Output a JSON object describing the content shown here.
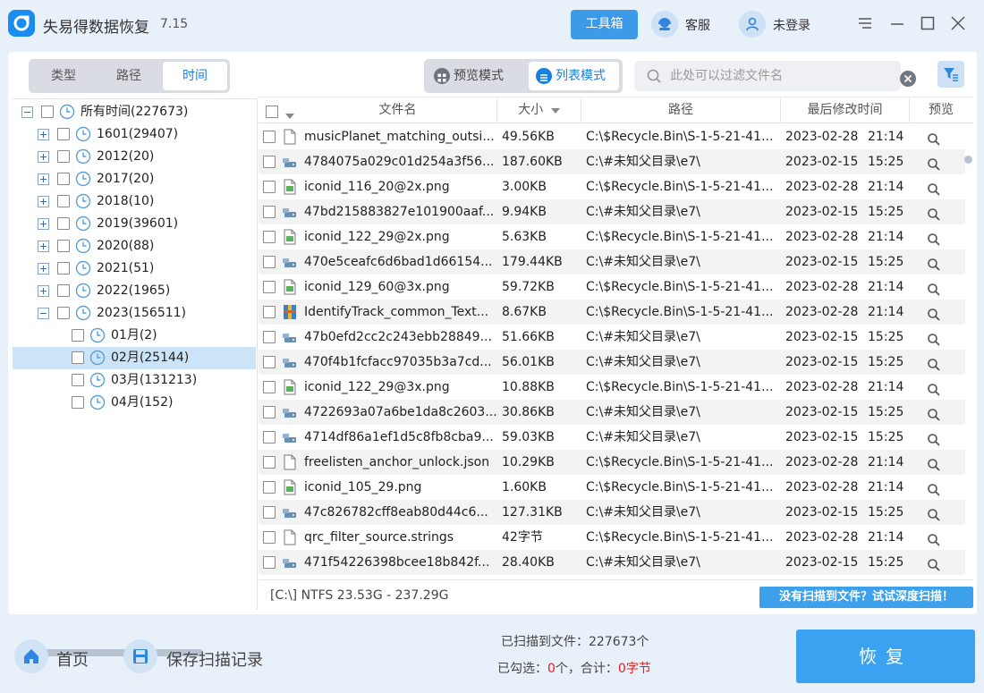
{
  "app": {
    "title": "失易得数据恢复",
    "version": "7.15"
  },
  "header": {
    "toolbox_label": "工具箱",
    "service_label": "客服",
    "login_label": "未登录"
  },
  "tabs": [
    {
      "label": "类型",
      "active": false
    },
    {
      "label": "路径",
      "active": false
    },
    {
      "label": "时间",
      "active": true
    }
  ],
  "view_modes": [
    {
      "label": "预览模式",
      "active": false
    },
    {
      "label": "列表模式",
      "active": true
    }
  ],
  "filter": {
    "placeholder": "此处可以过滤文件名",
    "value": ""
  },
  "tree": {
    "root": {
      "label": "所有时间(227673)"
    },
    "years": [
      {
        "label": "1601(29407)"
      },
      {
        "label": "2012(20)"
      },
      {
        "label": "2017(20)"
      },
      {
        "label": "2018(10)"
      },
      {
        "label": "2019(39601)"
      },
      {
        "label": "2020(88)"
      },
      {
        "label": "2021(51)"
      },
      {
        "label": "2022(1965)"
      },
      {
        "label": "2023(156511)"
      }
    ],
    "months": [
      {
        "label": "01月(2)"
      },
      {
        "label": "02月(25144)"
      },
      {
        "label": "03月(131213)"
      },
      {
        "label": "04月(152)"
      }
    ]
  },
  "table": {
    "columns": {
      "name": "文件名",
      "size": "大小",
      "path": "路径",
      "modified": "最后修改时间",
      "preview": "预览"
    },
    "rows": [
      {
        "name": "musicPlanet_matching_outsi...",
        "size": "49.56KB",
        "path": "C:\\$Recycle.Bin\\S-1-5-21-41...",
        "date": "2023-02-28",
        "time": "21:14",
        "icon": "blank-file-icon"
      },
      {
        "name": "4784075a029c01d254a3f56...",
        "size": "187.60KB",
        "path": "C:\\#未知父目录\\e7\\",
        "date": "2023-02-15",
        "time": "15:25",
        "icon": "drive-file-icon"
      },
      {
        "name": "iconid_116_20@2x.png",
        "size": "3.00KB",
        "path": "C:\\$Recycle.Bin\\S-1-5-21-41...",
        "date": "2023-02-28",
        "time": "21:14",
        "icon": "image-file-icon"
      },
      {
        "name": "47bd215883827e101900aaf...",
        "size": "9.94KB",
        "path": "C:\\#未知父目录\\e7\\",
        "date": "2023-02-15",
        "time": "15:25",
        "icon": "drive-file-icon"
      },
      {
        "name": "iconid_122_29@2x.png",
        "size": "5.63KB",
        "path": "C:\\$Recycle.Bin\\S-1-5-21-41...",
        "date": "2023-02-28",
        "time": "21:14",
        "icon": "image-file-icon"
      },
      {
        "name": "470e5ceafc6d6bad1d66154...",
        "size": "179.44KB",
        "path": "C:\\#未知父目录\\e7\\",
        "date": "2023-02-15",
        "time": "15:25",
        "icon": "drive-file-icon"
      },
      {
        "name": "iconid_129_60@3x.png",
        "size": "59.72KB",
        "path": "C:\\$Recycle.Bin\\S-1-5-21-41...",
        "date": "2023-02-28",
        "time": "21:14",
        "icon": "image-file-icon"
      },
      {
        "name": "IdentifyTrack_common_Text...",
        "size": "8.67KB",
        "path": "C:\\$Recycle.Bin\\S-1-5-21-41...",
        "date": "2023-02-28",
        "time": "21:14",
        "icon": "archive-file-icon"
      },
      {
        "name": "47b0efd2cc2c243ebb28849...",
        "size": "51.66KB",
        "path": "C:\\#未知父目录\\e7\\",
        "date": "2023-02-15",
        "time": "15:25",
        "icon": "drive-file-icon"
      },
      {
        "name": "470f4b1fcfacc97035b3a7cd...",
        "size": "56.01KB",
        "path": "C:\\#未知父目录\\e7\\",
        "date": "2023-02-15",
        "time": "15:25",
        "icon": "drive-file-icon"
      },
      {
        "name": "iconid_122_29@3x.png",
        "size": "10.88KB",
        "path": "C:\\$Recycle.Bin\\S-1-5-21-41...",
        "date": "2023-02-28",
        "time": "21:14",
        "icon": "image-file-icon"
      },
      {
        "name": "4722693a07a6be1da8c2603...",
        "size": "30.86KB",
        "path": "C:\\#未知父目录\\e7\\",
        "date": "2023-02-15",
        "time": "15:25",
        "icon": "drive-file-icon"
      },
      {
        "name": "4714df86a1ef1d5c8fb8cba9...",
        "size": "59.03KB",
        "path": "C:\\#未知父目录\\e7\\",
        "date": "2023-02-15",
        "time": "15:25",
        "icon": "drive-file-icon"
      },
      {
        "name": "freelisten_anchor_unlock.json",
        "size": "10.29KB",
        "path": "C:\\$Recycle.Bin\\S-1-5-21-41...",
        "date": "2023-02-28",
        "time": "21:14",
        "icon": "blank-file-icon"
      },
      {
        "name": "iconid_105_29.png",
        "size": "1.60KB",
        "path": "C:\\$Recycle.Bin\\S-1-5-21-41...",
        "date": "2023-02-28",
        "time": "21:14",
        "icon": "image-file-icon"
      },
      {
        "name": "47c826782cff8eab80d44c6...",
        "size": "127.31KB",
        "path": "C:\\#未知父目录\\e7\\",
        "date": "2023-02-15",
        "time": "15:25",
        "icon": "drive-file-icon"
      },
      {
        "name": "qrc_filter_source.strings",
        "size": "42字节",
        "path": "C:\\$Recycle.Bin\\S-1-5-21-41...",
        "date": "2023-02-28",
        "time": "21:14",
        "icon": "blank-file-icon"
      },
      {
        "name": "471f54226398bcee18b842f...",
        "size": "28.40KB",
        "path": "C:\\#未知父目录\\e7\\",
        "date": "2023-02-15",
        "time": "15:25",
        "icon": "drive-file-icon"
      }
    ]
  },
  "footer": {
    "drive_info": "[C:\\] NTFS 23.53G - 237.29G",
    "deep_scan_label": "没有扫描到文件？试试深度扫描！"
  },
  "bottom": {
    "home_label": "首页",
    "save_label": "保存扫描记录",
    "scanned_label": "已扫描到文件：",
    "scanned_count": "227673",
    "scanned_unit": "个",
    "selected_label": "已勾选：",
    "selected_count": "0",
    "selected_unit": "个，合计：",
    "total_size": "0字节",
    "recover_label": "恢复"
  },
  "colors": {
    "accent": "#1a80e0",
    "button": "#3aa2f0",
    "highlight": "#cce4f7",
    "warn": "#e02020"
  }
}
